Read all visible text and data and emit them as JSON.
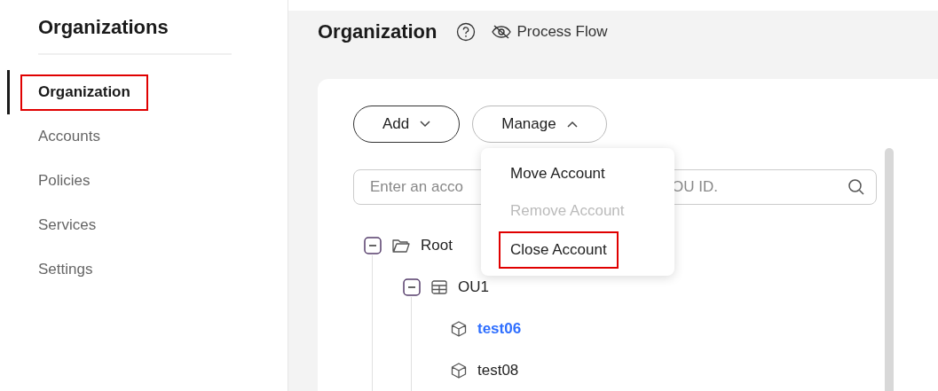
{
  "sidebar": {
    "title": "Organizations",
    "items": [
      {
        "label": "Organization",
        "selected": true,
        "highlighted": true
      },
      {
        "label": "Accounts",
        "selected": false,
        "highlighted": false
      },
      {
        "label": "Policies",
        "selected": false,
        "highlighted": false
      },
      {
        "label": "Services",
        "selected": false,
        "highlighted": false
      },
      {
        "label": "Settings",
        "selected": false,
        "highlighted": false
      }
    ]
  },
  "header": {
    "title": "Organization",
    "process_flow": "Process Flow"
  },
  "toolbar": {
    "buttons": [
      {
        "label": "Add",
        "expanded": false
      },
      {
        "label": "Manage",
        "expanded": true
      }
    ]
  },
  "manage_menu": {
    "items": [
      {
        "label": "Move Account",
        "disabled": false,
        "highlighted": false
      },
      {
        "label": "Remove Account",
        "disabled": true,
        "highlighted": false
      },
      {
        "label": "Close Account",
        "disabled": false,
        "highlighted": true
      }
    ]
  },
  "search": {
    "placeholder_start": "Enter an acco",
    "placeholder_end": "OU ID."
  },
  "tree": [
    {
      "label": "Root",
      "kind": "root",
      "expanded": true,
      "selected": false,
      "children": [
        {
          "label": "OU1",
          "kind": "ou",
          "expanded": true,
          "selected": false,
          "children": [
            {
              "label": "test06",
              "kind": "account",
              "selected": true
            },
            {
              "label": "test08",
              "kind": "account",
              "selected": false
            }
          ]
        }
      ]
    }
  ]
}
